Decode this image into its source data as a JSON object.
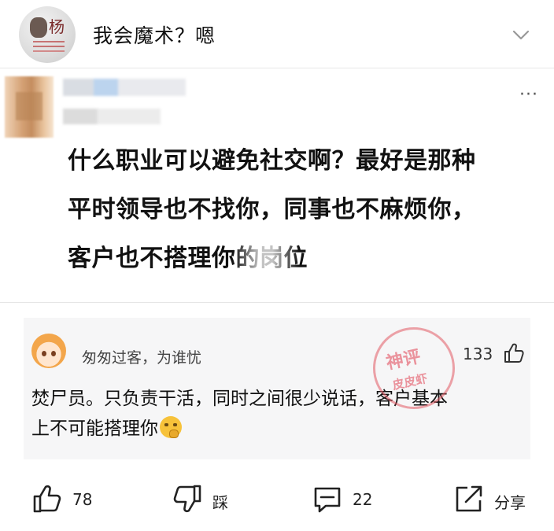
{
  "header": {
    "title": "我会魔术？嗯",
    "avatar_char": "杨",
    "icons": {
      "collapse": "chevron-down-icon"
    }
  },
  "post": {
    "lines": [
      "什么职业可以避免社交啊？最好是那种",
      "平时领导也不找你，同事也不麻烦你，",
      "客户也不搭理你的岗位"
    ],
    "more_icon": "more-dots-icon"
  },
  "comment": {
    "username": "匆匆过客，为谁忧",
    "likes": "133",
    "text_lines": [
      "焚尸员。只负责干活，同时之间很少说话，客户基本",
      "上不可能搭理你"
    ],
    "emoji": "thinking-emoji"
  },
  "watermark": {
    "top": "神评",
    "bottom": "皮皮虾"
  },
  "actions": {
    "like_count": "78",
    "dislike_label": "踩",
    "comment_count": "22",
    "share_label": "分享"
  },
  "colors": {
    "text": "#111111",
    "card_bg": "#f6f6f7",
    "divider": "#e6e6e6",
    "stamp": "#e2505f"
  }
}
